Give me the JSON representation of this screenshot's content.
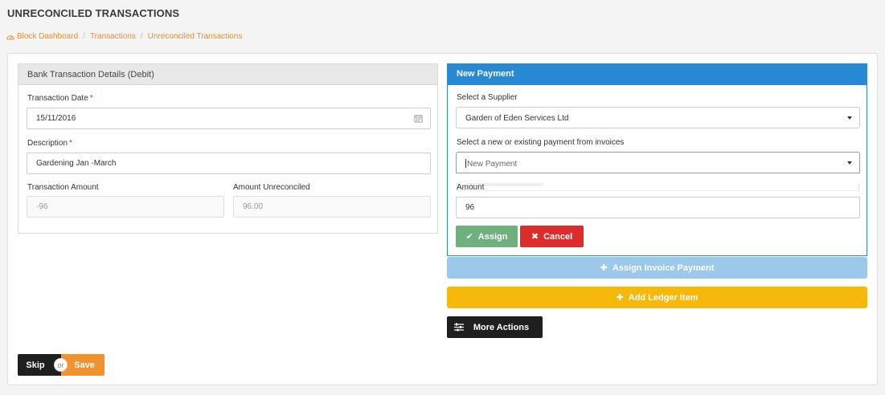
{
  "page": {
    "title": "UNRECONCILED TRANSACTIONS"
  },
  "breadcrumb": {
    "items": [
      "Block Dashboard",
      "Transactions",
      "Unreconciled Transactions"
    ],
    "icon": "dashboard-icon"
  },
  "bank_details": {
    "header": "Bank Transaction Details (Debit)",
    "transaction_date_label": "Transaction Date",
    "transaction_date_value": "15/11/2016",
    "description_label": "Description",
    "description_value": "Gardening Jan -March",
    "transaction_amount_label": "Transaction Amount",
    "transaction_amount_value": "-96",
    "amount_unreconciled_label": "Amount Unreconciled",
    "amount_unreconciled_value": "96.00",
    "required_marker": "*"
  },
  "new_payment": {
    "header": "New Payment",
    "supplier_label": "Select a Supplier",
    "supplier_value": "Garden of Eden Services Ltd",
    "payment_label": "Select a new or existing payment from invoices",
    "payment_placeholder": "New Payment",
    "amount_label": "Amount",
    "amount_value": "96",
    "assign_label": "Assign",
    "cancel_label": "Cancel"
  },
  "actions": {
    "assign_invoice_label": "Assign Invoice Payment",
    "add_ledger_label": "Add Ledger Item",
    "more_actions_label": "More Actions",
    "skip_label": "Skip",
    "or_label": "or",
    "save_label": "Save"
  },
  "colors": {
    "accent_orange": "#f0922e",
    "primary_blue": "#2789d3",
    "success_green": "#6fb07f",
    "danger_red": "#dc2c2c",
    "warning_yellow": "#f6b80a",
    "dark": "#1f1f1f"
  }
}
